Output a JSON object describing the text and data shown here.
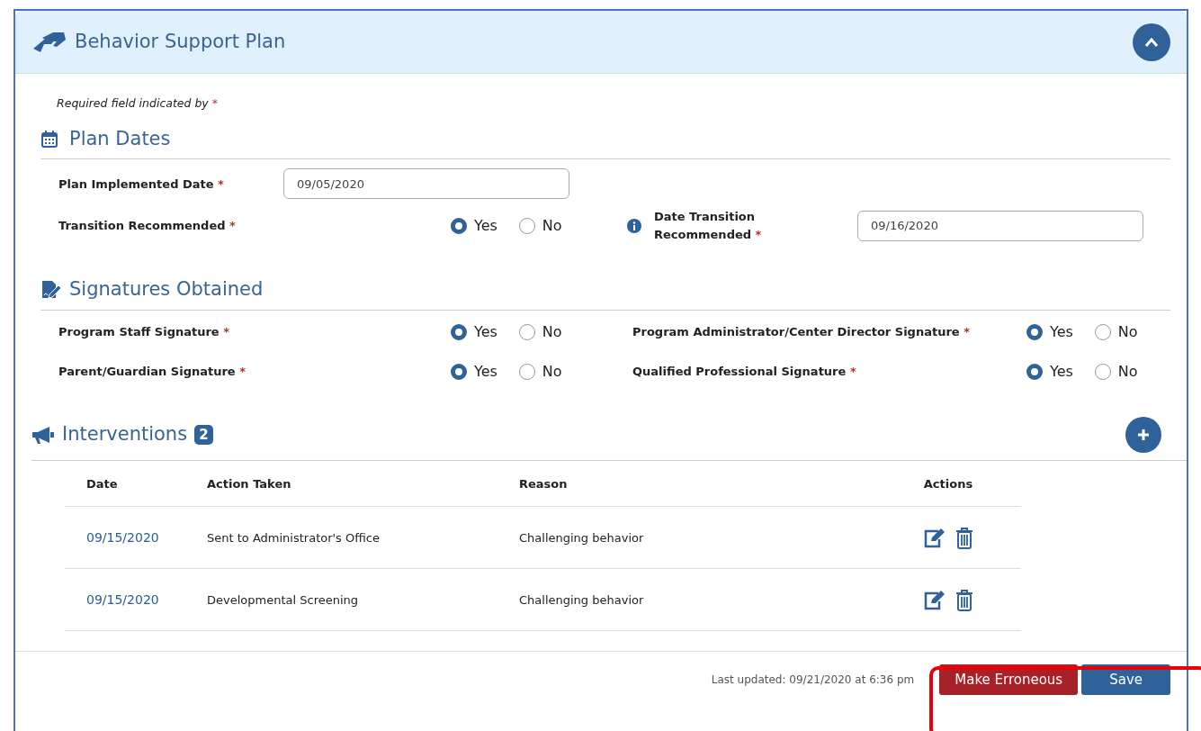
{
  "panel": {
    "title": "Behavior Support Plan",
    "expanded": true
  },
  "required_note": {
    "text": "Required field indicated by",
    "mark": "*"
  },
  "sections": [
    {
      "kind": "dates",
      "title": "Plan Dates",
      "rows": [
        {
          "kind": "date",
          "label": "Plan Implemented Date",
          "value": "09/05/2020"
        },
        {
          "kind": "radio_date",
          "label": "Transition Recommended",
          "options": [
            {
              "label": "Yes",
              "selected": true
            },
            {
              "label": "No",
              "selected": false
            }
          ],
          "side_label": "Date Transition Recommended",
          "side_value": "09/16/2020"
        }
      ]
    },
    {
      "kind": "signatures",
      "title": "Signatures Obtained",
      "rows": [
        {
          "kind": "radio_pair",
          "items": [
            {
              "label": "Program Staff Signature",
              "options": [
                {
                  "label": "Yes",
                  "selected": true
                },
                {
                  "label": "No",
                  "selected": false
                }
              ]
            },
            {
              "label": "Program Administrator/Center Director Signature",
              "options": [
                {
                  "label": "Yes",
                  "selected": true
                },
                {
                  "label": "No",
                  "selected": false
                }
              ]
            }
          ]
        },
        {
          "kind": "radio_pair",
          "items": [
            {
              "label": "Parent/Guardian Signature",
              "options": [
                {
                  "label": "Yes",
                  "selected": true
                },
                {
                  "label": "No",
                  "selected": false
                }
              ]
            },
            {
              "label": "Qualified Professional Signature",
              "options": [
                {
                  "label": "Yes",
                  "selected": true
                },
                {
                  "label": "No",
                  "selected": false
                }
              ]
            }
          ]
        }
      ]
    }
  ],
  "required_mark": "*",
  "interventions": {
    "title": "Interventions",
    "count": "2",
    "columns": [
      "Date",
      "Action Taken",
      "Reason",
      "Actions"
    ],
    "rows": [
      {
        "date": "09/15/2020",
        "action": "Sent to Administrator's Office",
        "reason": "Challenging behavior"
      },
      {
        "date": "09/15/2020",
        "action": "Developmental Screening",
        "reason": "Challenging behavior"
      }
    ]
  },
  "footer": {
    "last_updated": "Last updated: 09/21/2020 at 6:36 pm",
    "highlighted": true,
    "buttons": [
      {
        "kind": "danger",
        "label": "Make Erroneous"
      },
      {
        "kind": "primary",
        "label": "Save"
      }
    ]
  }
}
